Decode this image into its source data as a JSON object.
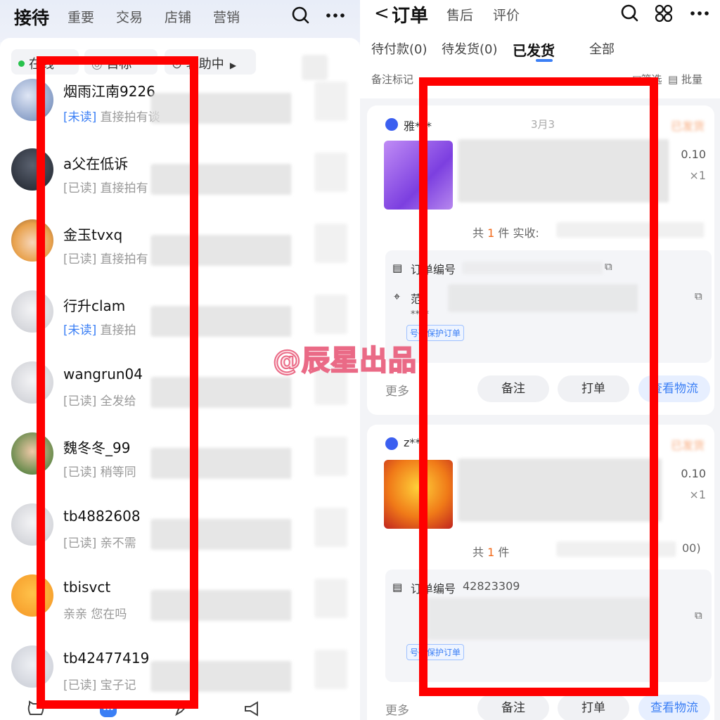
{
  "left": {
    "title": "接待",
    "tabs": [
      "重要",
      "交易",
      "店铺",
      "营销"
    ],
    "status": {
      "online": "在线",
      "target": "目标",
      "assist": "辅助中"
    },
    "chats": [
      {
        "name": "烟雨江南9226",
        "tag": "[未读]",
        "tag_type": "unread",
        "preview": "直接拍有谈"
      },
      {
        "name": "a父在低诉",
        "tag": "[已读]",
        "tag_type": "read",
        "preview": "直接拍有"
      },
      {
        "name": "金玉tvxq",
        "tag": "[已读]",
        "tag_type": "read",
        "preview": "直接拍有"
      },
      {
        "name": "行升clam",
        "tag": "[未读]",
        "tag_type": "unread",
        "preview": "直接拍"
      },
      {
        "name": "wangrun04",
        "tag": "[已读]",
        "tag_type": "read",
        "preview": "全发给"
      },
      {
        "name": "魏冬冬_99",
        "tag": "[已读]",
        "tag_type": "read",
        "preview": "稍等同"
      },
      {
        "name": "tb4882608",
        "tag": "[已读]",
        "tag_type": "read",
        "preview": "亲不需"
      },
      {
        "name": "tbisvct",
        "tag": "",
        "tag_type": "none",
        "preview": "亲亲 您在吗"
      },
      {
        "name": "tb42477419",
        "tag": "[已读]",
        "tag_type": "read",
        "preview": "宝子记"
      }
    ]
  },
  "right": {
    "back": "<",
    "title": "订单",
    "nav_tabs": [
      "售后",
      "评价"
    ],
    "order_tabs": [
      "待付款(0)",
      "待发货(0)",
      "已发货",
      "全部"
    ],
    "filters": {
      "remark": "备注标记",
      "filter": "筛选",
      "batch": "批量"
    },
    "orders": [
      {
        "buyer": "雅***",
        "date": "3月3",
        "status": "已发货",
        "price": "0.10",
        "qty": "×1",
        "summary_prefix": "共",
        "count": "1",
        "summary_suffix": "件  实收:",
        "order_no_label": "订单编号",
        "addr_prefix": "范",
        "masked_phone": "****",
        "protect": "号码保护订单",
        "more": "更多",
        "btn_remark": "备注",
        "btn_print": "打单",
        "btn_logistics": "查看物流"
      },
      {
        "buyer": "z**",
        "date": "",
        "status": "已发货",
        "price": "0.10",
        "qty": "×1",
        "summary_prefix": "共",
        "count": "1",
        "summary_suffix": "件",
        "summary_tail": "00)",
        "order_no_label": "订单编号",
        "order_no_partial": "42823309",
        "protect": "号码保护订单",
        "more": "更多",
        "btn_remark": "备注",
        "btn_print": "打单",
        "btn_logistics": "查看物流"
      }
    ]
  },
  "watermark": "@辰星出品",
  "colors": {
    "accent_blue": "#3b7ff5",
    "highlight_red": "#ff0000",
    "online_green": "#27c24c",
    "orange": "#f26a1b"
  }
}
